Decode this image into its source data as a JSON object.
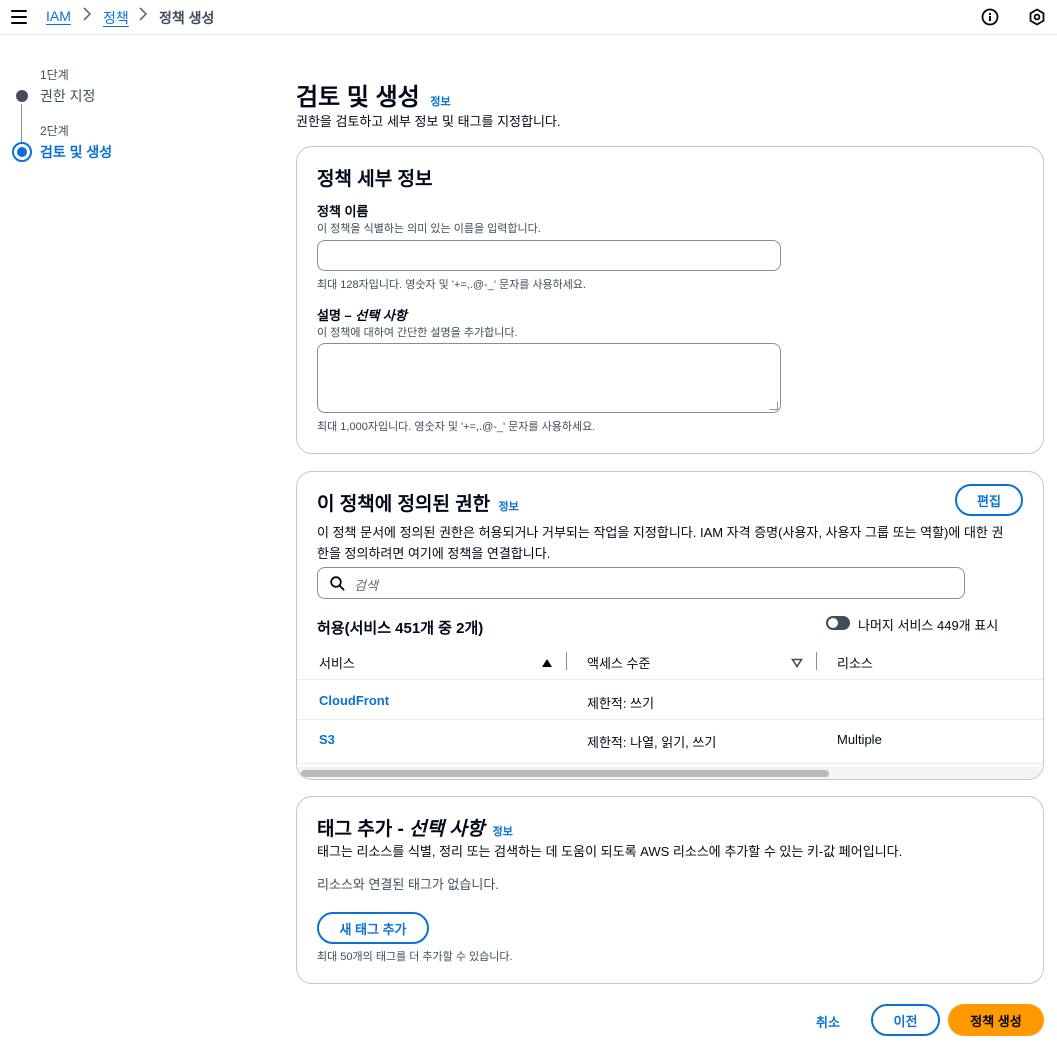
{
  "breadcrumb": {
    "items": [
      {
        "label": "IAM"
      },
      {
        "label": "정책"
      },
      {
        "label": "정책 생성"
      }
    ]
  },
  "steps": [
    {
      "number": "1단계",
      "label": "권한 지정"
    },
    {
      "number": "2단계",
      "label": "검토 및 생성"
    }
  ],
  "page": {
    "title": "검토 및 생성",
    "info": "정보",
    "subtitle": "권한을 검토하고 세부 정보 및 태그를 지정합니다."
  },
  "details": {
    "title": "정책 세부 정보",
    "name_label": "정책 이름",
    "name_desc": "이 정책을 식별하는 의미 있는 이름을 입력합니다.",
    "name_value": "",
    "name_hint": "최대 128자입니다. 영숫자 및 '+=,.@-_' 문자를 사용하세요.",
    "desc_label": "설명 – ",
    "desc_label_optional": "선택 사항",
    "desc_desc": "이 정책에 대하여 간단한 설명을 추가합니다.",
    "desc_value": "",
    "desc_hint": "최대 1,000자입니다. 영숫자 및 '+=,.@-_' 문자를 사용하세요."
  },
  "permissions": {
    "title": "이 정책에 정의된 권한",
    "info": "정보",
    "edit_label": "편집",
    "desc_line1": "이 정책 문서에 정의된 권한은 허용되거나 거부되는 작업을 지정합니다. IAM 자격 증명(사용자, 사용자 그룹 또는 역할)에 대한 권",
    "desc_line2": "한을 정의하려면 여기에 정책을 연결합니다.",
    "search_placeholder": "검색",
    "allow_heading": "허용(서비스 451개 중 2개)",
    "toggle_label": "나머지 서비스 449개 표시",
    "columns": [
      "서비스",
      "액세스 수준",
      "리소스"
    ],
    "rows": [
      {
        "service": "CloudFront",
        "access": "제한적: 쓰기",
        "resource": ""
      },
      {
        "service": "S3",
        "access": "제한적: 나열, 읽기, 쓰기",
        "resource": "Multiple"
      }
    ]
  },
  "tags": {
    "title": "태그 추가 - ",
    "title_optional": "선택 사항",
    "info": "정보",
    "desc": "태그는 리소스를 식별, 정리 또는 검색하는 데 도움이 되도록 AWS 리소스에 추가할 수 있는 키-값 페어입니다.",
    "empty": "리소스와 연결된 태그가 없습니다.",
    "add_label": "새 태그 추가",
    "hint": "최대 50개의 태그를 더 추가할 수 있습니다."
  },
  "footer": {
    "cancel": "취소",
    "previous": "이전",
    "create": "정책 생성"
  },
  "colors": {
    "link": "#0972d3",
    "primary": "#ff9900",
    "text": "#000716"
  }
}
